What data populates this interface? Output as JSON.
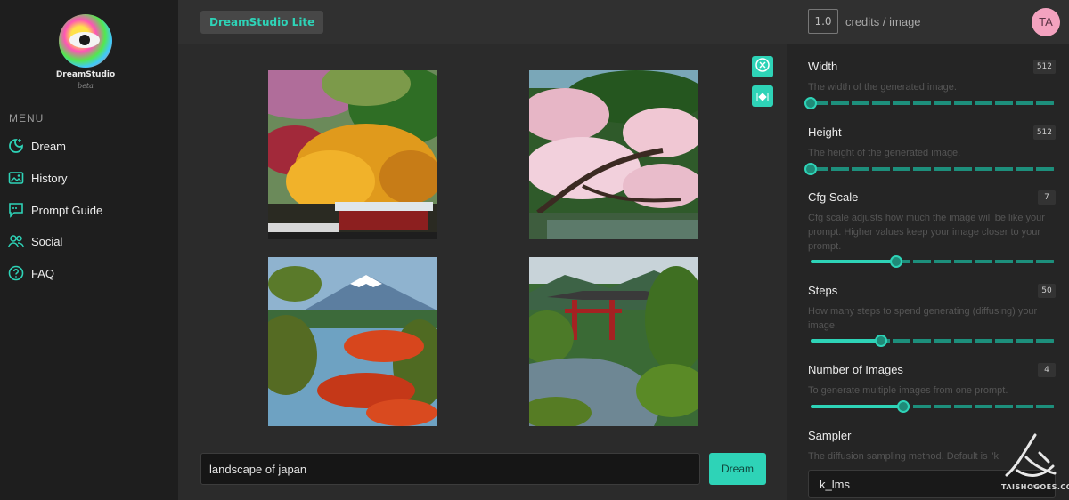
{
  "app": {
    "brand": "DreamStudio",
    "brand_sub": "beta",
    "chip": "DreamStudio Lite"
  },
  "header": {
    "credits_value": "1.0",
    "credits_label": "credits / image",
    "avatar_initials": "TA"
  },
  "sidebar": {
    "menu_title": "MENU",
    "items": [
      {
        "label": "Dream",
        "icon": "dream-icon"
      },
      {
        "label": "History",
        "icon": "history-icon"
      },
      {
        "label": "Prompt Guide",
        "icon": "prompt-guide-icon"
      },
      {
        "label": "Social",
        "icon": "social-icon"
      },
      {
        "label": "FAQ",
        "icon": "faq-icon"
      }
    ]
  },
  "gallery": {
    "images": [
      {
        "subject": "autumn trees and temple"
      },
      {
        "subject": "cherry blossom tree by pond"
      },
      {
        "subject": "mount fuji with red maple"
      },
      {
        "subject": "red torii gate and pond"
      }
    ]
  },
  "prompt": {
    "value": "landscape of japan",
    "button": "Dream"
  },
  "settings": {
    "width": {
      "title": "Width",
      "value": "512",
      "desc": "The width of the generated image.",
      "level": 0.0
    },
    "height": {
      "title": "Height",
      "value": "512",
      "desc": "The height of the generated image.",
      "level": 0.0
    },
    "cfg": {
      "title": "Cfg Scale",
      "value": "7",
      "desc": "Cfg scale adjusts how much the image will be like your prompt. Higher values keep your image closer to your prompt.",
      "level": 0.35
    },
    "steps": {
      "title": "Steps",
      "value": "50",
      "desc": "How many steps to spend generating (diffusing) your image.",
      "level": 0.29
    },
    "num_images": {
      "title": "Number of Images",
      "value": "4",
      "desc": "To generate multiple images from one prompt.",
      "level": 0.38
    },
    "sampler": {
      "title": "Sampler",
      "desc": "The diffusion sampling method. Default is \"k",
      "value": "k_lms"
    }
  },
  "watermark": "TAISHOGOES.COM",
  "colors": {
    "accent": "#2ed3b7",
    "panel": "#252525",
    "topbar": "#303030"
  }
}
